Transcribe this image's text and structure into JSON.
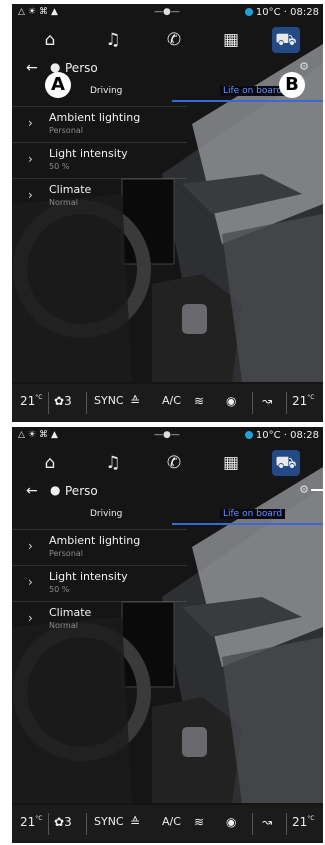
{
  "status": {
    "temperature": "10°C",
    "time": "08:28"
  },
  "nav_icons": [
    "home-icon",
    "music-icon",
    "phone-icon",
    "apps-icon",
    "car-icon"
  ],
  "header": {
    "title": "Perso"
  },
  "tabs": [
    {
      "label": "Driving"
    },
    {
      "label": "Life on board"
    }
  ],
  "menu": [
    {
      "label": "Ambient lighting",
      "value": "Personal"
    },
    {
      "label": "Light intensity",
      "value": "50 %"
    },
    {
      "label": "Climate",
      "value": "Normal"
    }
  ],
  "bottom": {
    "temp_left": "21",
    "unit": "°C",
    "fan": "3",
    "sync": "SYNC",
    "ac": "A/C",
    "temp_right": "21"
  },
  "callouts": {
    "a": "A",
    "b": "B"
  }
}
